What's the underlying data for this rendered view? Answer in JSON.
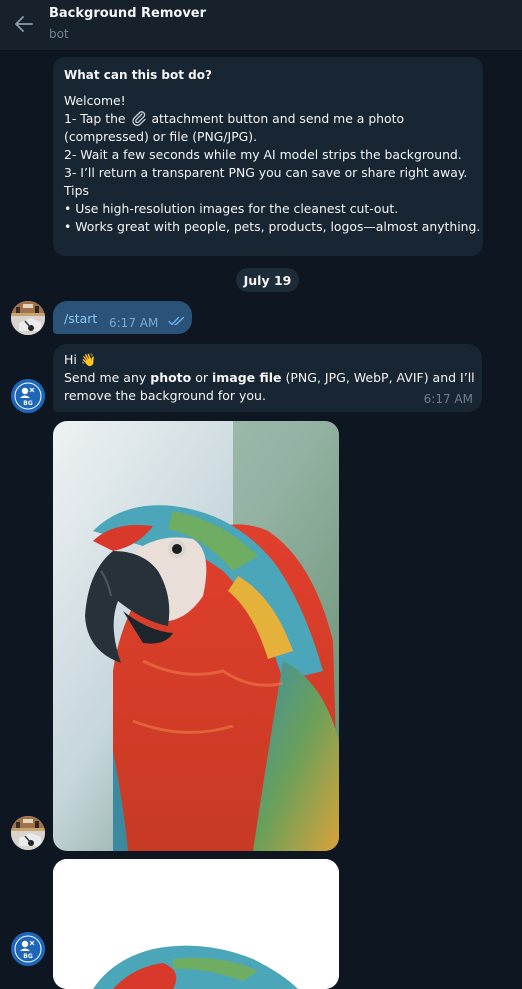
{
  "header": {
    "title": "Background Remover",
    "subtitle": "bot"
  },
  "bot_info": {
    "title": "What can this bot do?",
    "lines": [
      "Welcome!",
      "1- Tap the",
      "attachment button and send me a photo",
      "(compressed) or file (PNG/JPG).",
      "2- Wait a few seconds while my AI model strips the background.",
      "3- I’ll return a transparent PNG you can save or share right away.",
      "Tips",
      "• Use high-resolution images for the cleanest cut-out.",
      "• Works great with people, pets, products, logos—almost anything."
    ]
  },
  "date_separator": "July 19",
  "messages": [
    {
      "type": "outgoing",
      "text": "/start",
      "time": "6:17 AM",
      "status": "read"
    },
    {
      "type": "incoming",
      "greeting": "Hi",
      "emoji": "👋",
      "parts": [
        "Send me any ",
        "photo",
        " or ",
        "image file",
        " (PNG, JPG, WebP, AVIF) and I’ll"
      ],
      "line2": "remove the background for you.",
      "time": "6:17 AM"
    }
  ],
  "bot_avatar_text": "BG",
  "colors": {
    "background": "#0e1621",
    "header": "#17212b",
    "bubble_in": "#182533",
    "bubble_out": "#2b5278",
    "read_check": "#6ab3f3"
  }
}
